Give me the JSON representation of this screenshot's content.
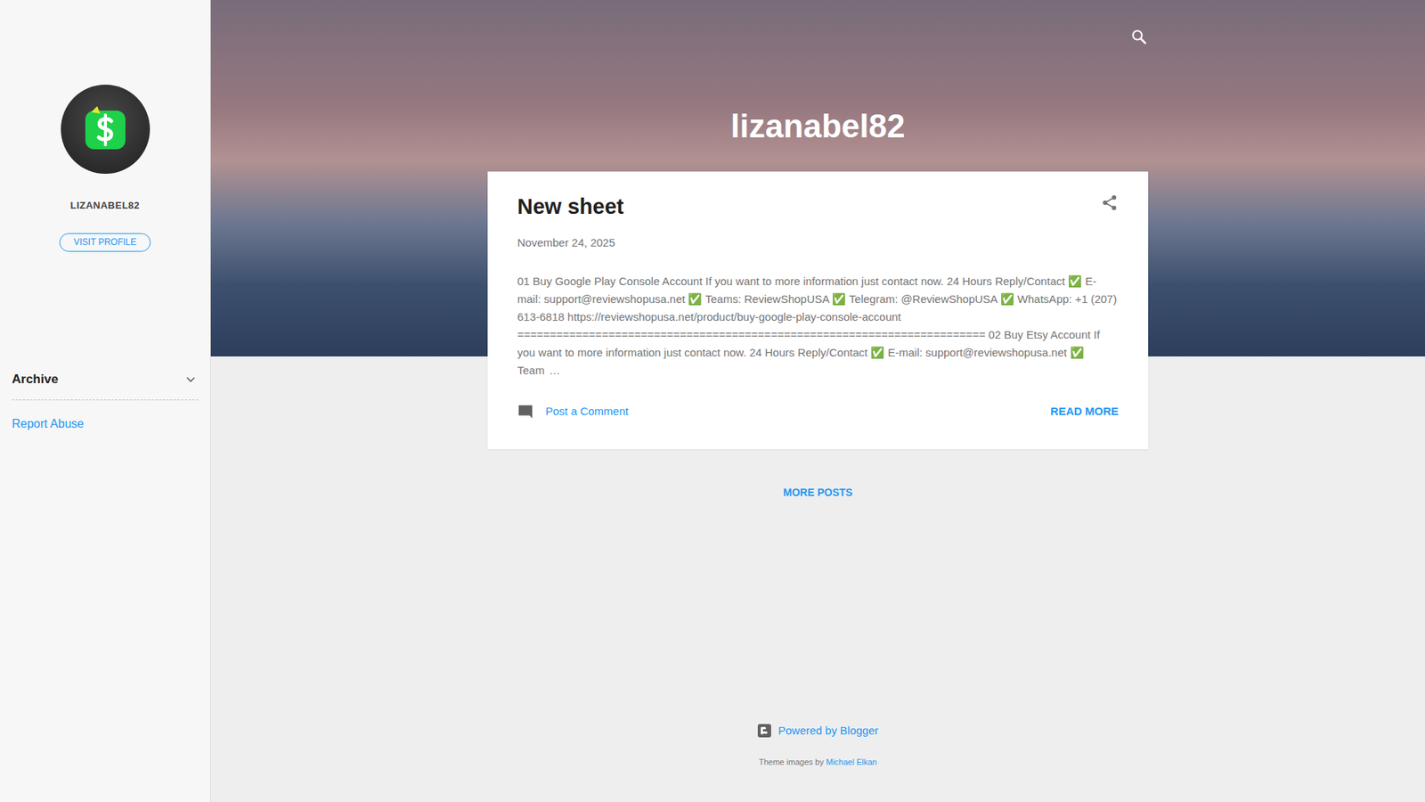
{
  "blog": {
    "title": "lizanabel82"
  },
  "sidebar": {
    "profile_name": "LIZANABEL82",
    "visit_button": "VISIT PROFILE",
    "archive": {
      "label": "Archive",
      "expanded": false
    },
    "report_link": "Report Abuse"
  },
  "post": {
    "title": "New sheet",
    "date": "November 24, 2025",
    "snippet": "01 Buy Google Play Console Account If you want to more information just contact now. 24 Hours Reply/Contact ✅ E-mail: support@reviewshopusa.net ✅ Teams: ReviewShopUSA ✅ Telegram: @ReviewShopUSA ✅ WhatsApp: +1 (207) 613-6818 https://reviewshopusa.net/product/buy-google-play-console-account ======================================================================== 02 Buy Etsy Account If you want to more information just contact now. 24 Hours Reply/Contact ✅ E-mail: support@reviewshopusa.net ✅ Team",
    "ellipsis": "…",
    "comment_link": "Post a Comment",
    "read_more": "READ MORE"
  },
  "more_posts": "MORE POSTS",
  "footer": {
    "powered": "Powered by Blogger",
    "theme_prefix": "Theme images by",
    "theme_author": "Michael Elkan"
  }
}
